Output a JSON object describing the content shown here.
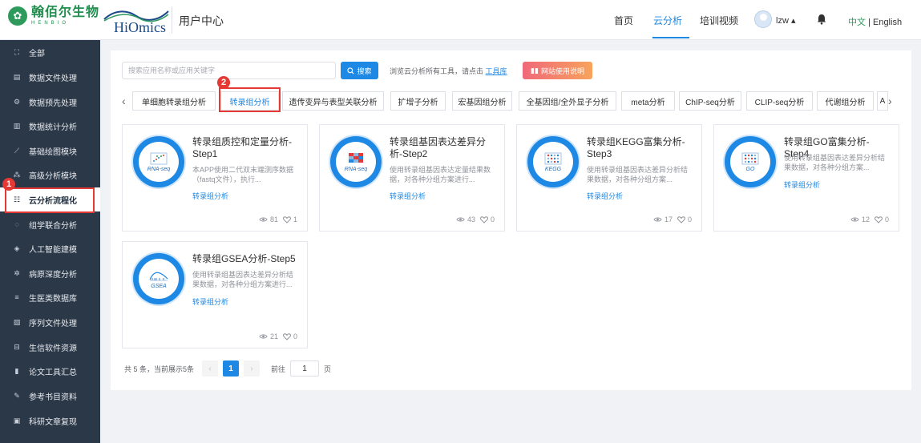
{
  "header": {
    "logo1_cn": "翰佰尔生物",
    "logo1_en": "HENBIO",
    "logo2_text": "HiOmics",
    "title": "用户中心",
    "nav": [
      "首页",
      "云分析",
      "培训视频"
    ],
    "active_nav": "云分析",
    "user": "lzw ▴",
    "lang_cn": "中文",
    "lang_sep": " | ",
    "lang_en": "English"
  },
  "sidebar": {
    "items": [
      {
        "label": "全部",
        "icon": "grid-icon"
      },
      {
        "label": "数据文件处理",
        "icon": "file-icon"
      },
      {
        "label": "数据预先处理",
        "icon": "gear-icon"
      },
      {
        "label": "数据统计分析",
        "icon": "bar-chart-icon"
      },
      {
        "label": "基础绘图模块",
        "icon": "line-chart-icon"
      },
      {
        "label": "高级分析模块",
        "icon": "nodes-icon"
      },
      {
        "label": "云分析流程化",
        "icon": "flow-icon"
      },
      {
        "label": "组学联合分析",
        "icon": "cycle-icon"
      },
      {
        "label": "人工智能建模",
        "icon": "chip-icon"
      },
      {
        "label": "病原深度分析",
        "icon": "virus-icon"
      },
      {
        "label": "生医类数据库",
        "icon": "database-icon"
      },
      {
        "label": "序列文件处理",
        "icon": "document-icon"
      },
      {
        "label": "生信软件资源",
        "icon": "box-icon"
      },
      {
        "label": "论文工具汇总",
        "icon": "books-icon"
      },
      {
        "label": "参考书目资料",
        "icon": "pen-icon"
      },
      {
        "label": "科研文章复现",
        "icon": "article-icon"
      }
    ],
    "active_index": 6
  },
  "annotations": {
    "badge1": "1",
    "badge2": "2"
  },
  "search": {
    "placeholder": "搜索应用名称或应用关键字",
    "button": "搜索",
    "browse_text": "浏览云分析所有工具，请点击",
    "browse_link": "工具库",
    "guide_button": "网站使用说明"
  },
  "tabs": {
    "items": [
      "单细胞转录组分析",
      "转录组分析",
      "遗传变异与表型关联分析",
      "扩增子分析",
      "宏基因组分析",
      "全基因组/全外显子分析",
      "meta分析",
      "ChIP-seq分析",
      "CLIP-seq分析",
      "代谢组分析",
      "A"
    ],
    "active_index": 1
  },
  "cards": [
    {
      "title": "转录组质控和定量分析-Step1",
      "desc": "本APP使用二代双末端测序数据（fastq文件），执行...",
      "tag": "转录组分析",
      "views": "81",
      "likes": "1",
      "icon_caption": "RNA-seq"
    },
    {
      "title": "转录组基因表达差异分析-Step2",
      "desc": "使用转录组基因表达定量结果数据，对各种分组方案进行...",
      "tag": "转录组分析",
      "views": "43",
      "likes": "0",
      "icon_caption": "RNA-seq"
    },
    {
      "title": "转录组KEGG富集分析-Step3",
      "desc": "使用转录组基因表达差异分析结果数据，对各种分组方案...",
      "tag": "转录组分析",
      "views": "17",
      "likes": "0",
      "icon_caption": "KEGG"
    },
    {
      "title": "转录组GO富集分析-Step4",
      "desc": "使用转录组基因表达差异分析结果数据，对各种分组方案...",
      "tag": "转录组分析",
      "views": "12",
      "likes": "0",
      "icon_caption": "GO"
    },
    {
      "title": "转录组GSEA分析-Step5",
      "desc": "使用转录组基因表达差异分析结果数据，对各种分组方案进行...",
      "tag": "转录组分析",
      "views": "21",
      "likes": "0",
      "icon_caption": "GSEA"
    }
  ],
  "pagination": {
    "summary": "共 5 条，当前展示5条",
    "prev": "‹",
    "current": "1",
    "next": "›",
    "goto_label": "前往",
    "goto_value": "1",
    "page_suffix": "页"
  },
  "colors": {
    "brand_green": "#2e9a5c",
    "accent_blue": "#1e88e5",
    "sidebar_bg": "#2b3848",
    "highlight_red": "#e53935"
  }
}
